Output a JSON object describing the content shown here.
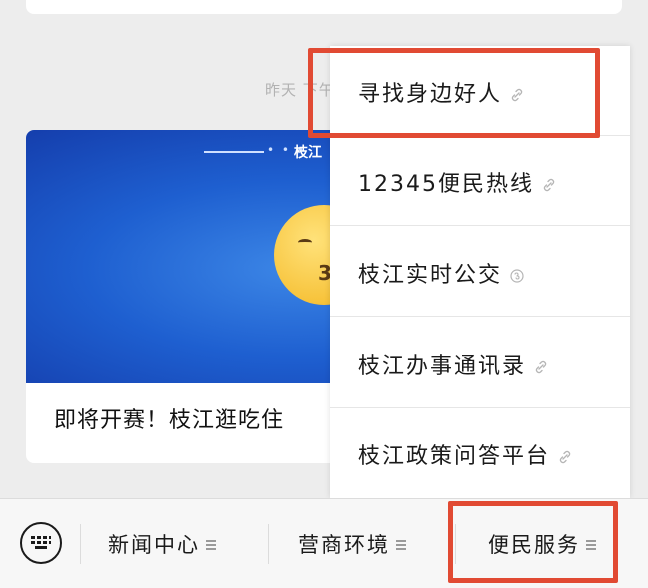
{
  "timestamp": "昨天 下午",
  "article": {
    "cover_brand": "枝江",
    "cover_dots": "• • •",
    "title": "即将开赛！枝江逛吃住"
  },
  "popup_menu": {
    "items": [
      {
        "label": "寻找身边好人",
        "icon": "link-icon"
      },
      {
        "label": "12345便民热线",
        "icon": "link-icon"
      },
      {
        "label": "枝江实时公交",
        "icon": "miniprogram-icon"
      },
      {
        "label": "枝江办事通讯录",
        "icon": "link-icon"
      },
      {
        "label": "枝江政策问答平台",
        "icon": "link-icon"
      }
    ]
  },
  "bottom_menu": {
    "keyboard_icon": "keyboard-icon",
    "tabs": [
      {
        "label": "新闻中心"
      },
      {
        "label": "营商环境"
      },
      {
        "label": "便民服务"
      }
    ]
  },
  "colors": {
    "highlight": "#e14a33",
    "cover_blue": "#1e5fd0"
  }
}
